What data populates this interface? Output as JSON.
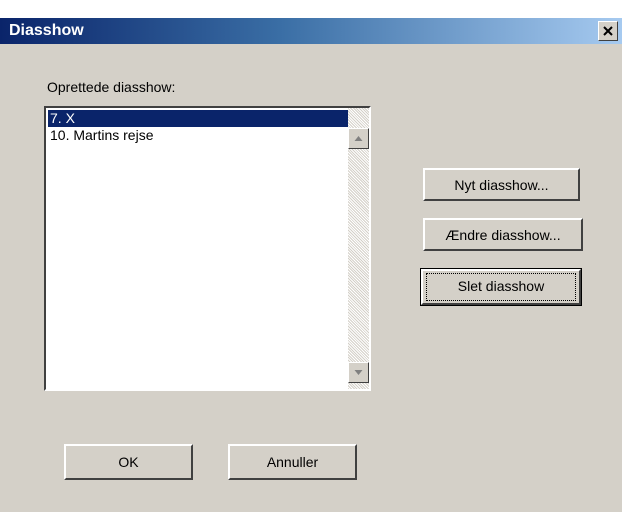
{
  "window": {
    "title": "Diasshow",
    "close_icon": "close-icon"
  },
  "list": {
    "label": "Oprettede diasshow:",
    "items": [
      {
        "label": "7. X",
        "selected": true
      },
      {
        "label": "10. Martins rejse",
        "selected": false
      }
    ],
    "scroll_up_icon": "arrow-up-icon",
    "scroll_down_icon": "arrow-down-icon"
  },
  "actions": {
    "new_label": "Nyt diasshow...",
    "edit_label": "Ændre diasshow...",
    "delete_label": "Slet diasshow"
  },
  "footer": {
    "ok_label": "OK",
    "cancel_label": "Annuller"
  },
  "colors": {
    "dialog_face": "#d4d0c8",
    "titlebar_start": "#0a246a",
    "titlebar_end": "#a6caf0",
    "selection": "#0a246a"
  }
}
